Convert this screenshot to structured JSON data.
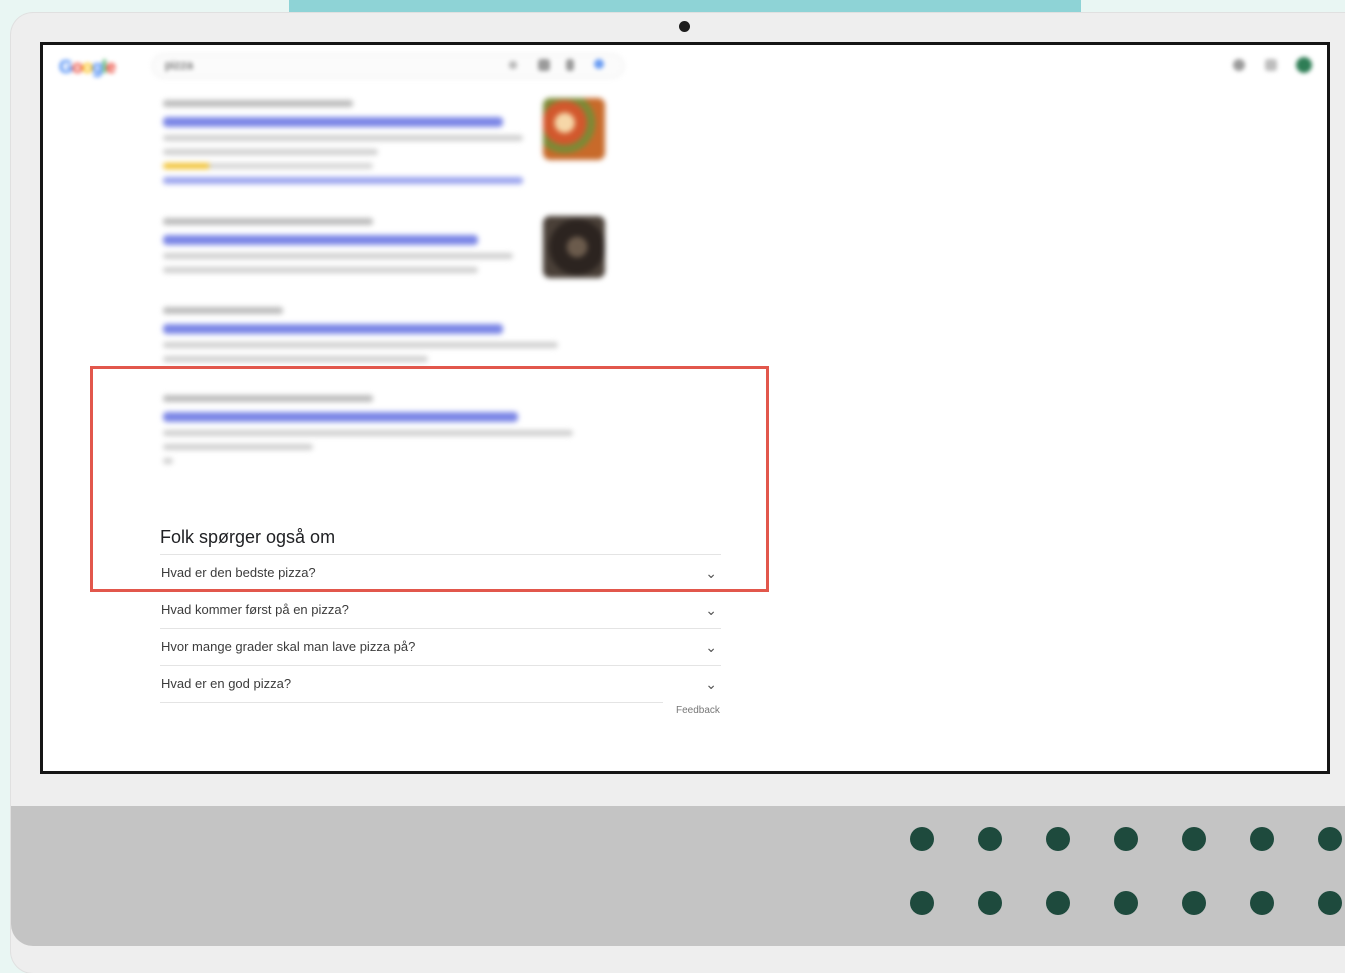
{
  "search_page": {
    "logo_text": "Google",
    "query": "pizza",
    "people_also_ask": {
      "title": "Folk spørger også om",
      "questions": [
        "Hvad er den bedste pizza?",
        "Hvad kommer først på en pizza?",
        "Hvor mange grader skal man lave pizza på?",
        "Hvad er en god pizza?"
      ],
      "chevron": "⌄",
      "feedback_label": "Feedback"
    }
  },
  "colors": {
    "highlight": "#e2574c",
    "dots": "#1e4a3d",
    "accent_bar": "#8ed3d6"
  },
  "icons": [
    "camera-icon",
    "chevron-down-icon",
    "settings-icon",
    "apps-grid-icon",
    "account-avatar-icon"
  ]
}
